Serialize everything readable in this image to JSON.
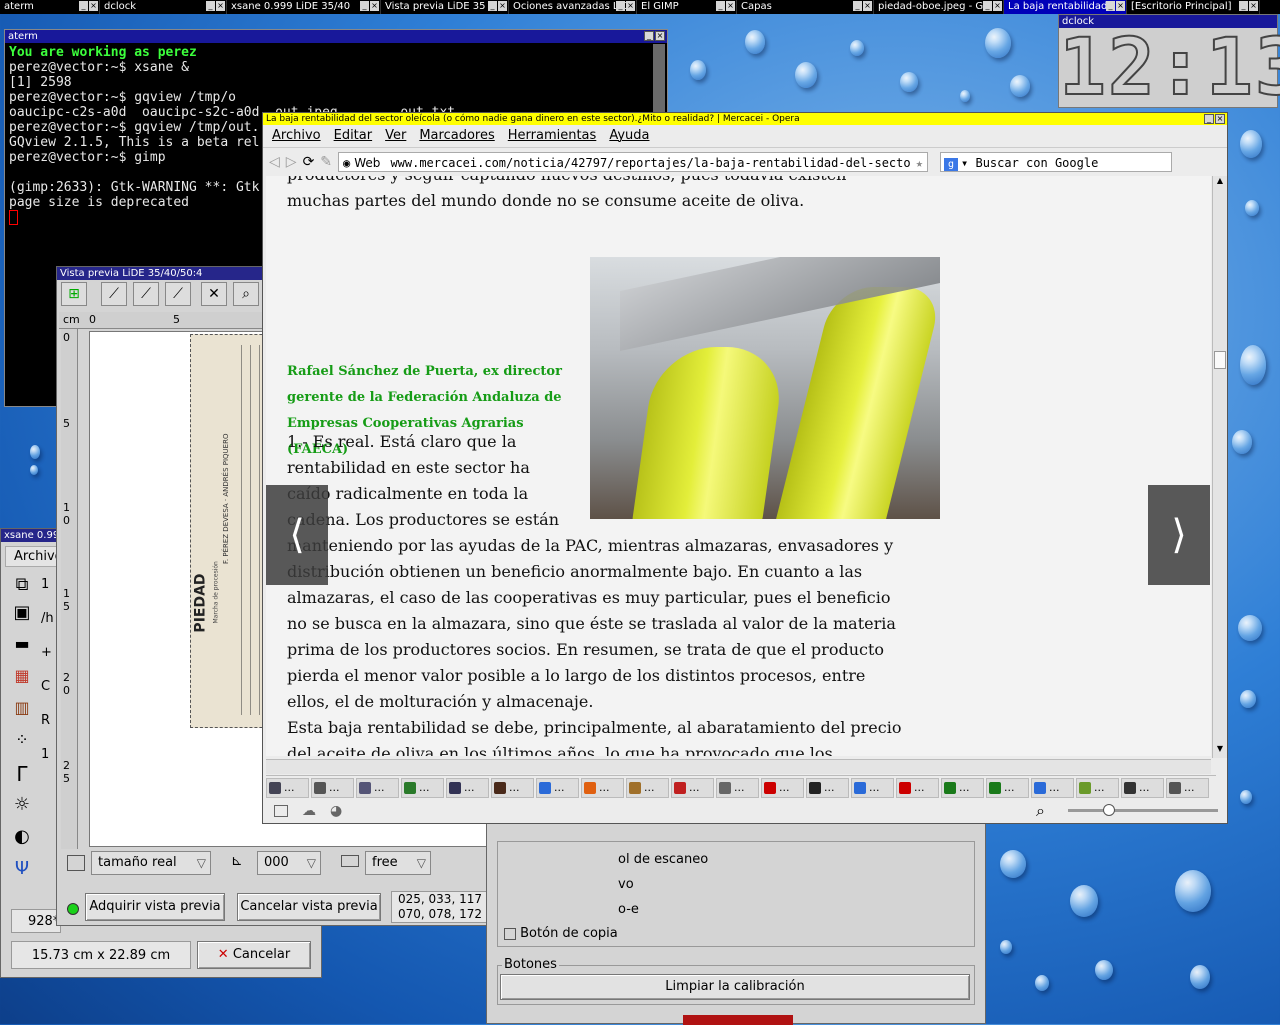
{
  "taskbar": [
    {
      "label": "aterm",
      "active": false
    },
    {
      "label": "dclock",
      "active": false
    },
    {
      "label": "xsane 0.999 LiDE 35/40",
      "active": false
    },
    {
      "label": "Vista previa LiDE 35",
      "active": false
    },
    {
      "label": "Ociones avanzadas LiD",
      "active": false
    },
    {
      "label": "El GIMP",
      "active": false
    },
    {
      "label": "Capas",
      "active": false
    },
    {
      "label": "piedad-oboe.jpeg - G",
      "active": false
    },
    {
      "label": "La baja rentabilidad",
      "active": true
    },
    {
      "label": "[Escritorio Principal]",
      "active": false
    }
  ],
  "aterm": {
    "title": "aterm",
    "lines": [
      "You are working as perez",
      "perez@vector:~$ xsane &",
      "[1] 2598",
      "perez@vector:~$ gqview /tmp/o",
      "oaucipc-c2s-a0d  oaucipc-s2c-a0d  out.jpeg        out.txt",
      "perez@vector:~$ gqview /tmp/out.",
      "GQview 2.1.5, This is a beta rel",
      "perez@vector:~$ gimp",
      "",
      "(gimp:2633): Gtk-WARNING **: Gtk",
      "page size is deprecated"
    ]
  },
  "dclock": {
    "title": "dclock",
    "time": "12:13"
  },
  "preview": {
    "title": "Vista previa LiDE 35/40/50:4",
    "ruler_unit": "cm",
    "ruler_top": [
      "0",
      "5"
    ],
    "ruler_left": [
      "0",
      "5",
      "1 0",
      "1 5",
      "2 0",
      "2 5"
    ],
    "doc_text": {
      "title": "PIEDAD",
      "author": "F. PÉREZ DEVESA · ANDRÉS PIQUERO",
      "subtitle": "Marcha de procesión"
    },
    "zoom_combo": "tamaño real",
    "rotation_combo": "000",
    "ratio_combo": "free",
    "acquire_button": "Adquirir vista previa",
    "cancel_button": "Cancelar vista previa",
    "rgb_values": [
      "025, 033, 117",
      "070, 078, 172"
    ]
  },
  "xsane": {
    "title": "xsane 0.999",
    "menu": "Archivo",
    "size_label": "15.73 cm x 22.89 cm",
    "cancel_button": "Cancelar",
    "dpi_value": "928*",
    "field_values": [
      "1",
      "/h",
      "+",
      "C",
      "R",
      "1"
    ]
  },
  "scanopts": {
    "items": [
      "ol de escaneo",
      "vo",
      "o-e",
      "Botón de copia"
    ],
    "group_label": "Botones",
    "calibrate_button": "Limpiar la calibración"
  },
  "opera": {
    "title": "La baja rentabilidad del sector oleícola (o cómo nadie gana dinero en este sector).¿Mito o realidad? | Mercacei - Opera",
    "menu": [
      "Archivo",
      "Editar",
      "Ver",
      "Marcadores",
      "Herramientas",
      "Ayuda"
    ],
    "web_label": "Web",
    "url": "www.mercacei.com/noticia/42797/reportajes/la-baja-rentabilidad-del-secto",
    "search_placeholder": "Buscar con Google",
    "top_text": "productores y seguir captando nuevos destinos, pues todavía existen",
    "top_text2": "muchas partes del mundo donde no se consume aceite de oliva.",
    "caption": "Rafael Sánchez de Puerta, ex director gerente de la Federación Andaluza de Empresas Cooperativas Agrarias (FAECA)",
    "body_lines_short": [
      "1.- Es real. Está claro que la",
      "rentabilidad en este sector ha",
      "caído radicalmente en toda la",
      "cadena. Los productores se están"
    ],
    "body_lines": [
      "manteniendo por las ayudas de la PAC, mientras almazaras, envasadores y",
      "distribución obtienen un beneficio anormalmente bajo. En cuanto a las",
      "almazaras, el caso de las cooperativas es muy particular, pues el beneficio",
      "no se busca en la almazara, sino que éste se traslada al valor de la materia",
      "prima de los productores socios. En resumen, se trata de que el producto",
      "pierda el menor valor posible a lo largo de los distintos procesos, entre",
      "ellos, el de molturación y almacenaje.",
      "Esta baja rentabilidad se debe, principalmente, al abaratamiento del precio",
      "del aceite de oliva en los últimos años, lo que ha provocado que los"
    ],
    "tabs": [
      "...",
      "...",
      "...",
      "...",
      "...",
      "...",
      "...",
      "...",
      "...",
      "...",
      "...",
      "...",
      "...",
      "...",
      "...",
      "...",
      "...",
      "...",
      "...",
      "...",
      "..."
    ]
  }
}
